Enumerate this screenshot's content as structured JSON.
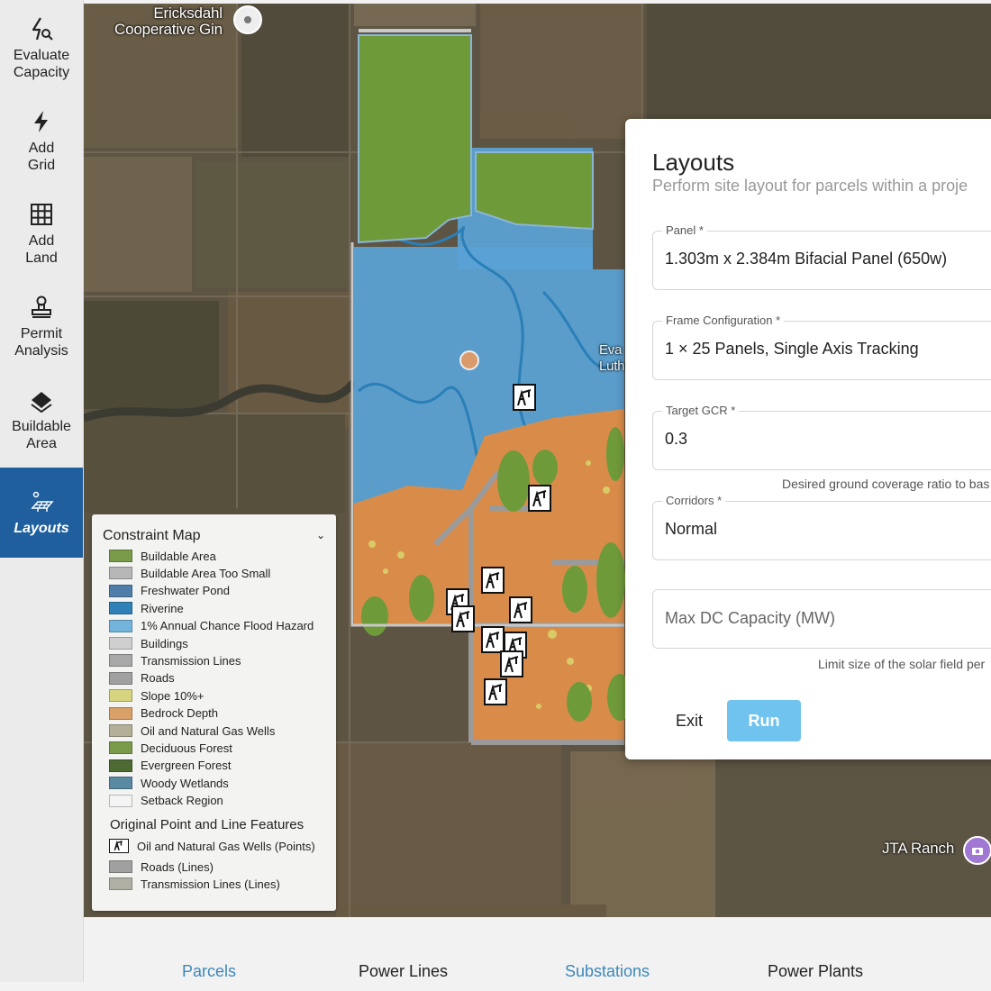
{
  "sidebar": {
    "items": [
      {
        "label": "Evaluate\nCapacity",
        "icon": "bolt-search-icon",
        "active": false
      },
      {
        "label": "Add\nGrid",
        "icon": "bolt-icon",
        "active": false
      },
      {
        "label": "Add\nLand",
        "icon": "grid-icon",
        "active": false
      },
      {
        "label": "Permit\nAnalysis",
        "icon": "stamp-icon",
        "active": false
      },
      {
        "label": "Buildable\nArea",
        "icon": "layers-icon",
        "active": false
      },
      {
        "label": "Layouts",
        "icon": "solar-panel-icon",
        "active": true
      }
    ]
  },
  "map": {
    "labels": {
      "gin": "Ericksdahl\nCooperative Gin",
      "church": "Eva\nLuthera",
      "ranch": "JTA Ranch"
    },
    "colors": {
      "buildable": "#6f9a3a",
      "flood": "#5aa3d6",
      "riverine": "#2a7fb8",
      "bedrock": "#d98c4a",
      "slope": "#d9d26a",
      "roads": "#9a9a9a"
    }
  },
  "legend": {
    "title": "Constraint Map",
    "items": [
      {
        "label": "Buildable Area",
        "color": "#7a9c4a"
      },
      {
        "label": "Buildable Area Too Small",
        "color": "#b7b7b7"
      },
      {
        "label": "Freshwater Pond",
        "color": "#4f7fa8"
      },
      {
        "label": "Riverine",
        "color": "#2f81b7"
      },
      {
        "label": "1% Annual Chance Flood Hazard",
        "color": "#74b4dc"
      },
      {
        "label": "Buildings",
        "color": "#cfcfcf"
      },
      {
        "label": "Transmission Lines",
        "color": "#a8a8a8"
      },
      {
        "label": "Roads",
        "color": "#a0a0a0"
      },
      {
        "label": "Slope 10%+",
        "color": "#d8d37f"
      },
      {
        "label": "Bedrock Depth",
        "color": "#d9a068"
      },
      {
        "label": "Oil and Natural Gas Wells",
        "color": "#b3b098"
      },
      {
        "label": "Deciduous Forest",
        "color": "#7a9c4a"
      },
      {
        "label": "Evergreen Forest",
        "color": "#4d6b33"
      },
      {
        "label": "Woody Wetlands",
        "color": "#5a8aa1"
      },
      {
        "label": "Setback Region",
        "color": "#f4f4f4"
      }
    ],
    "subtitle": "Original Point and Line Features",
    "features": [
      {
        "label": "Oil and Natural Gas Wells (Points)",
        "icon": "oil-well-icon"
      },
      {
        "label": "Roads (Lines)",
        "color": "#a0a0a0"
      },
      {
        "label": "Transmission Lines (Lines)",
        "color": "#b0b0a4"
      }
    ]
  },
  "panel": {
    "title": "Layouts",
    "subtitle": "Perform site layout for parcels within a proje",
    "fields": {
      "panel_label": "Panel *",
      "panel_value": "1.303m x 2.384m Bifacial Panel (650w)",
      "frame_label": "Frame Configuration *",
      "frame_value": "1 × 25 Panels, Single Axis Tracking",
      "gcr_label": "Target GCR *",
      "gcr_value": "0.3",
      "gcr_helper": "Desired ground coverage ratio to bas",
      "corridors_label": "Corridors *",
      "corridors_value": "Normal",
      "capacity_placeholder": "Max DC Capacity (MW)",
      "capacity_helper": "Limit size of the solar field per"
    },
    "exit_label": "Exit",
    "run_label": "Run"
  },
  "tabs": [
    {
      "label": "Parcels",
      "link": true
    },
    {
      "label": "Power Lines",
      "link": false
    },
    {
      "label": "Substations",
      "link": true
    },
    {
      "label": "Power Plants",
      "link": false
    }
  ]
}
